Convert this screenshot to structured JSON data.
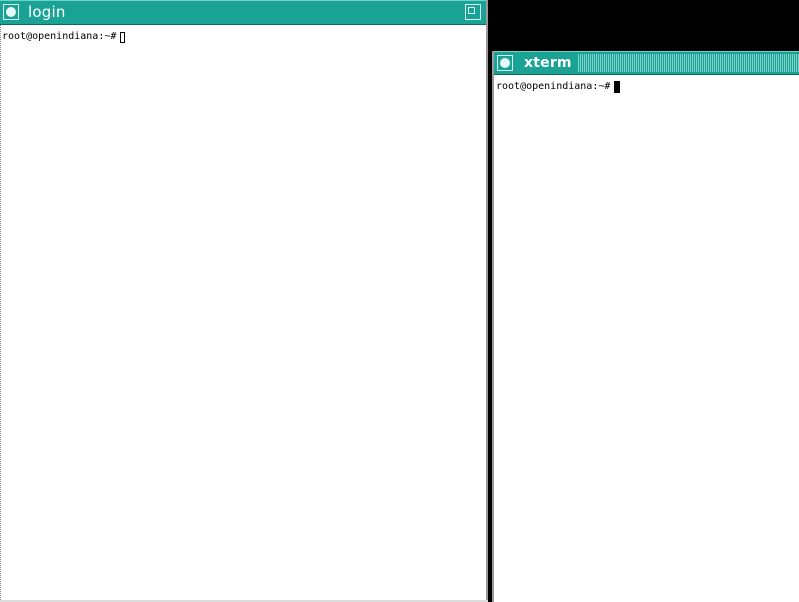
{
  "desktop": {
    "background_color": "#000000"
  },
  "windows": {
    "login": {
      "title": "login",
      "prompt": "root@openindiana:~#",
      "cursor_style": "hollow",
      "title_color": "#1aa394"
    },
    "xterm": {
      "title": "xterm",
      "prompt": "root@openindiana:~#",
      "cursor_style": "solid",
      "title_color": "#1aa394"
    }
  },
  "icons": {
    "window_menu": "window-menu-icon",
    "maximize": "maximize-icon"
  }
}
